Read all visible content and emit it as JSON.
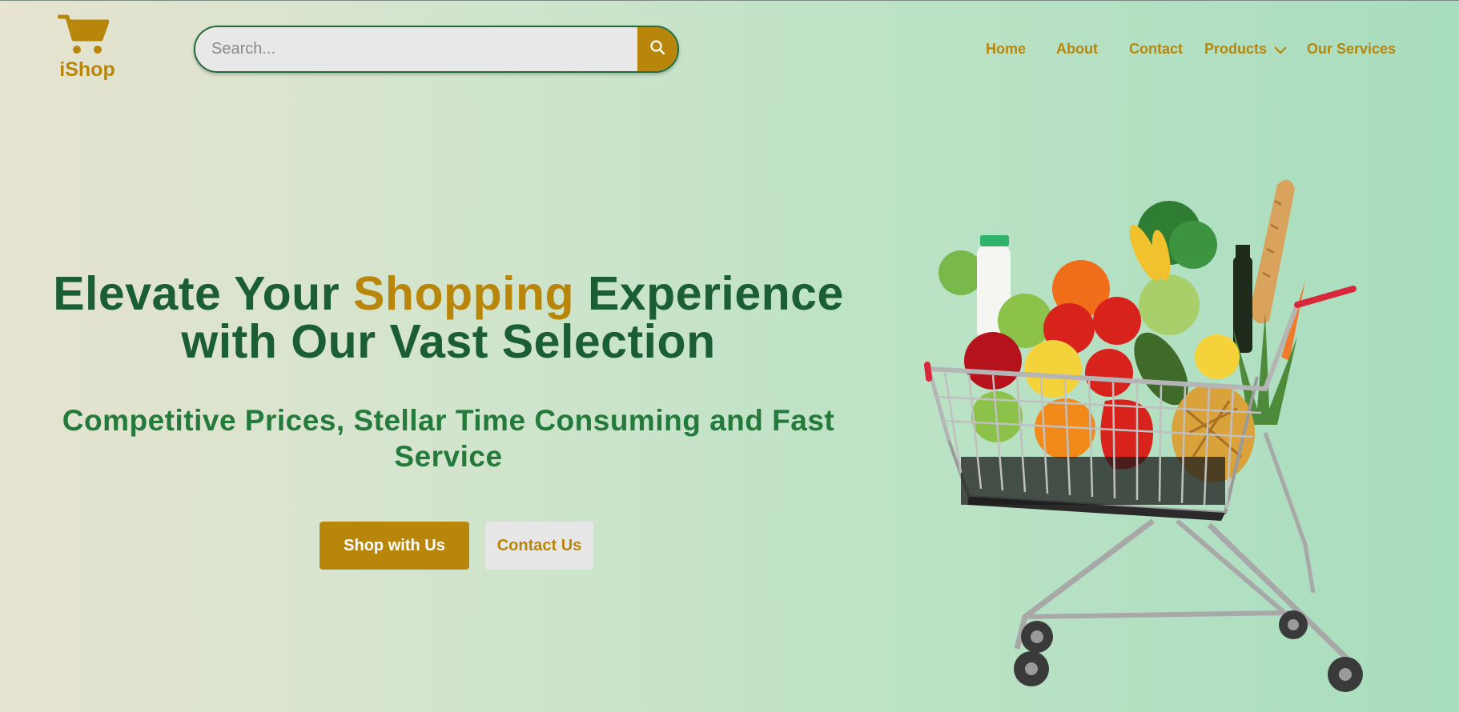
{
  "brand": {
    "name": "iShop",
    "icon": "shopping-cart-icon"
  },
  "search": {
    "placeholder": "Search...",
    "value": "",
    "button_icon": "search-icon"
  },
  "nav": {
    "items": [
      {
        "label": "Home"
      },
      {
        "label": "About"
      },
      {
        "label": "Contact"
      },
      {
        "label": "Products",
        "icon": "chevron-down-icon"
      },
      {
        "label": "Our Services"
      }
    ]
  },
  "hero": {
    "title_part1": "Elevate Your ",
    "title_accent": "Shopping",
    "title_part2": " Experience",
    "title_line2": "with Our Vast Selection",
    "subtitle": "Competitive Prices, Stellar Time Consuming and Fast Service",
    "primary_button": "Shop with Us",
    "secondary_button": "Contact Us",
    "image": "grocery-cart-illustration"
  },
  "colors": {
    "accent": "#b8860b",
    "heading": "#1b5e33",
    "subheading": "#237a3b",
    "search_border": "#1f6a3a"
  }
}
